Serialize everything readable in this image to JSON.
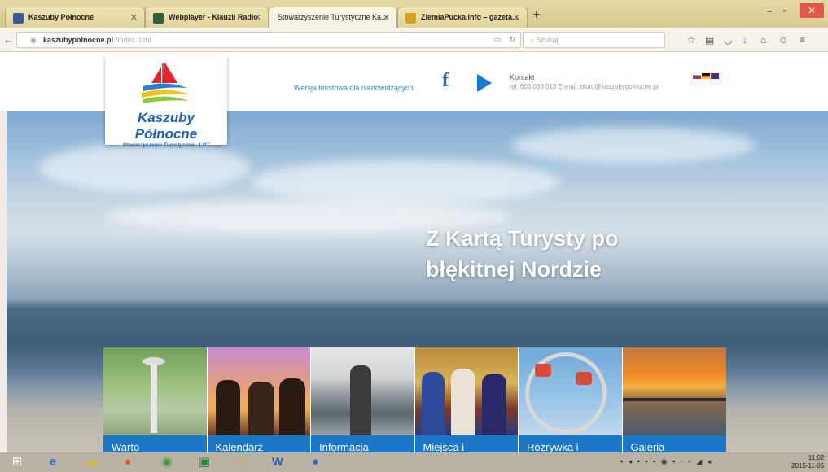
{
  "browser": {
    "tabs": [
      {
        "label": "Kaszuby Północne",
        "active": false
      },
      {
        "label": "Webplayer - Klauzli Radio",
        "active": false
      },
      {
        "label": "Stowarzyszenie Turystyczne Ka...",
        "active": true
      },
      {
        "label": "ZiemiaPucka.info – gazeta...",
        "active": false
      }
    ],
    "url_host": "kaszubypolnocne.pl",
    "url_path": "/index.html",
    "search_placeholder": "Szukaj"
  },
  "site": {
    "logo_title": "Kaszuby Północne",
    "logo_subtitle": "Stowarzyszenie Turystyczne - LOT",
    "accessibility_link": "Wersja tekstowa dla niedowidzących",
    "facebook_glyph": "f",
    "contact_title": "Kontakt",
    "contact_line": "tel. 603 039 013    E-mail: biuro@kaszubypolnocne.pl",
    "hero_line1": "Z Kartą Turysty po",
    "hero_line2": "błękitnej Nordzie",
    "tiles": [
      {
        "label": "Warto"
      },
      {
        "label": "Kalendarz"
      },
      {
        "label": "Informacja"
      },
      {
        "label": "Miejsca i"
      },
      {
        "label": "Rozrywka i"
      },
      {
        "label": "Galeria"
      }
    ]
  },
  "taskbar": {
    "clock_time": "11:02",
    "clock_date": "2015-11-05"
  },
  "colors": {
    "accent_blue": "#1b77c8",
    "logo_blue": "#1f63b4",
    "link_blue": "#2d8fd0"
  }
}
